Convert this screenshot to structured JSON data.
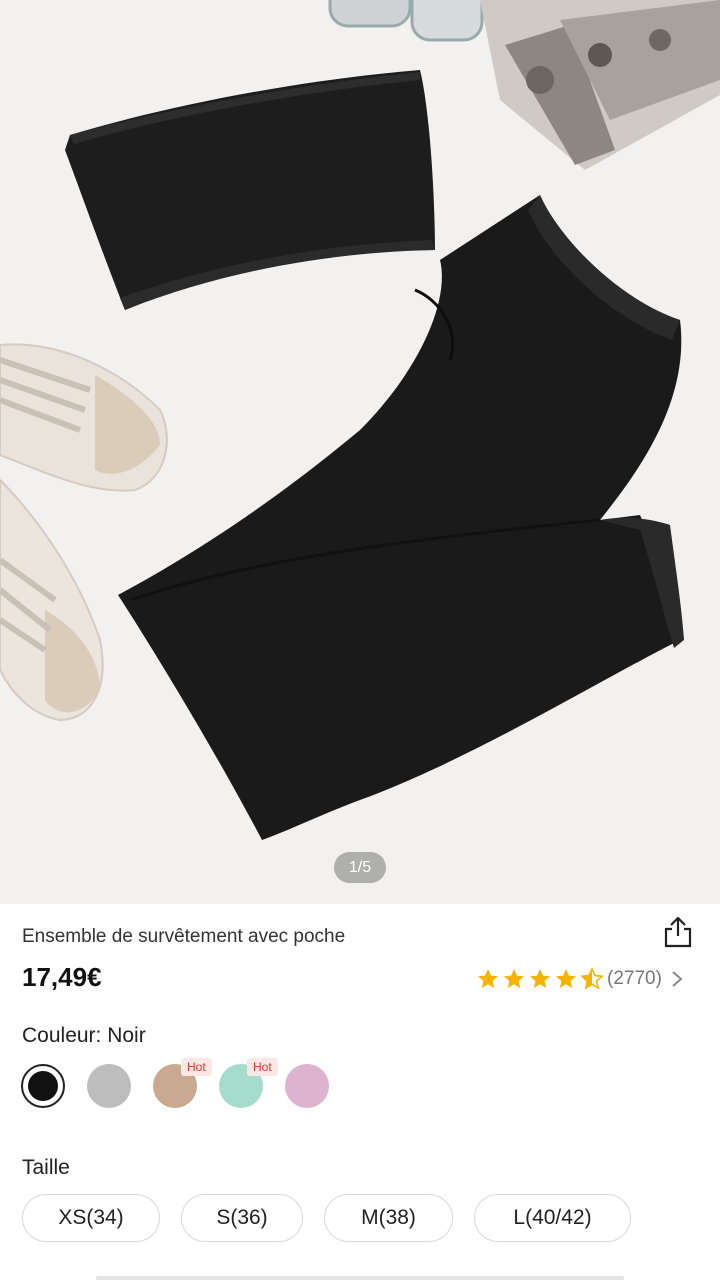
{
  "gallery": {
    "counter": "1/5",
    "current_image": 1,
    "total_images": 5
  },
  "product": {
    "title": "Ensemble de survêtement avec poche",
    "price": "17,49€",
    "rating": {
      "stars": 4.5,
      "count_label": "(2770)"
    }
  },
  "color": {
    "label": "Couleur: Noir",
    "swatches": [
      {
        "name": "Noir",
        "hex": "#111111",
        "selected": true,
        "badge": ""
      },
      {
        "name": "Gris",
        "hex": "#bdbdbd",
        "selected": false,
        "badge": ""
      },
      {
        "name": "Kaki",
        "hex": "#c9a98f",
        "selected": false,
        "badge": "Hot"
      },
      {
        "name": "Menthe",
        "hex": "#a6dccb",
        "selected": false,
        "badge": "Hot"
      },
      {
        "name": "Rose",
        "hex": "#ddb3cf",
        "selected": false,
        "badge": ""
      }
    ]
  },
  "size": {
    "label": "Taille",
    "options": [
      "XS(34)",
      "S(36)",
      "M(38)",
      "L(40/42)"
    ]
  },
  "colors": {
    "star": "#f6b400",
    "hot_text": "#e5362c"
  },
  "icons": {
    "share": "share-icon",
    "chevron": "chevron-right-icon",
    "star": "star-icon"
  }
}
